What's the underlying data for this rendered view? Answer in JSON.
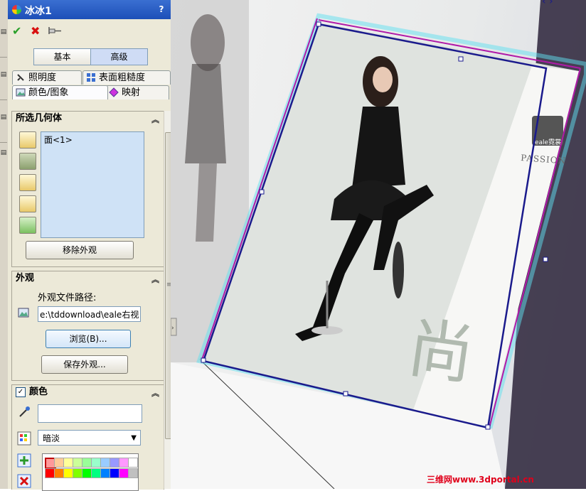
{
  "window": {
    "title": "冰冰1",
    "help": "?"
  },
  "actions": {
    "ok": "✔",
    "cancel": "✖",
    "pin": "pin"
  },
  "mode_tabs": {
    "basic": "基本",
    "advanced": "高级"
  },
  "tabs": {
    "row1": [
      {
        "label": "照明度"
      },
      {
        "label": "表面粗糙度"
      }
    ],
    "row2": [
      {
        "label": "颜色/图象"
      },
      {
        "label": "映射"
      }
    ]
  },
  "geometry": {
    "header": "所选几何体",
    "list_items": [
      "面<1>"
    ],
    "remove_label": "移除外观"
  },
  "appearance": {
    "header": "外观",
    "path_label": "外观文件路径:",
    "path_value": "e:\\tddownload\\eale右视",
    "browse_label": "浏览(B)...",
    "save_label": "保存外观..."
  },
  "color": {
    "header": "颜色",
    "checked": true,
    "shade_value": "暗淡",
    "swatches": [
      "#ff9999",
      "#ffcc99",
      "#ffff99",
      "#ccff99",
      "#99ff99",
      "#99ffcc",
      "#99ccff",
      "#9999ff",
      "#ff99ff",
      "#ffffff",
      "#ff0000",
      "#ff8000",
      "#ffff00",
      "#80ff00",
      "#00ff00",
      "#00ff80",
      "#0080ff",
      "#0000ff",
      "#ff00ff",
      "#c0c0c0"
    ]
  },
  "viewport": {
    "logo_text": "PASSION",
    "logo_brand": "eale霓裳",
    "kanji": "尚",
    "watermark": "三维网www.3dportal.cn"
  },
  "colors": {
    "title_blue": "#1d4fb8",
    "panel_bg": "#ece9d8",
    "sketch_blue": "#1a1a8c",
    "sketch_magenta": "#b01aa8",
    "highlight_cyan": "#5fe0f0"
  }
}
